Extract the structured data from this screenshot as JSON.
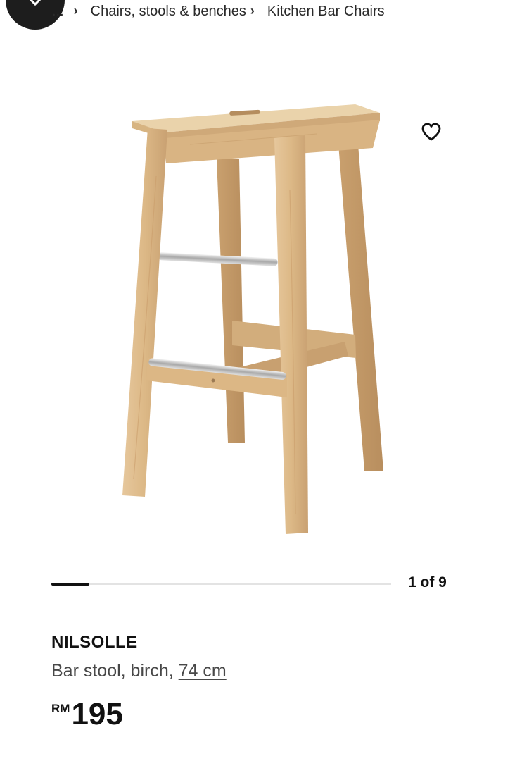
{
  "breadcrumb": {
    "ellipsis": "...",
    "items": [
      "Chairs, stools & benches",
      "Kitchen Bar Chairs"
    ]
  },
  "carousel": {
    "counter": "1 of 9",
    "current": 1,
    "total": 9
  },
  "product": {
    "name": "NILSOLLE",
    "description_prefix": "Bar stool, birch, ",
    "measurement": "74 cm",
    "price_currency": "RM",
    "price_amount": "195"
  },
  "icons": {
    "close": "close-icon",
    "wishlist": "heart-outline-icon",
    "chevron": "chevron-right-icon"
  },
  "colors": {
    "text_primary": "#111111",
    "text_secondary": "#484848",
    "wood": "#d9b98a"
  }
}
